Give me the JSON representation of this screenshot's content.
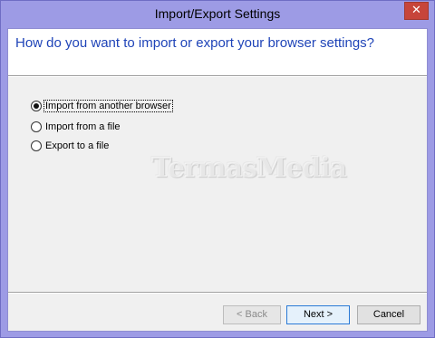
{
  "window": {
    "title": "Import/Export Settings",
    "close_glyph": "✕"
  },
  "header": {
    "question": "How do you want to import or export your browser settings?"
  },
  "options": [
    {
      "label": "Import from another browser",
      "checked": true
    },
    {
      "label": "Import from a file",
      "checked": false
    },
    {
      "label": "Export to a file",
      "checked": false
    }
  ],
  "watermark": "TermasMedia",
  "buttons": {
    "back": "< Back",
    "next": "Next >",
    "cancel": "Cancel"
  }
}
